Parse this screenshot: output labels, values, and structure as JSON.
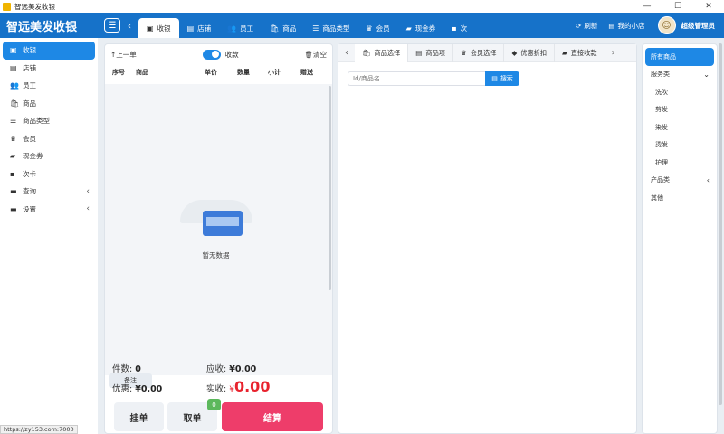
{
  "window": {
    "title": "智远美发收银",
    "buttons": [
      "—",
      "☐",
      "✕"
    ]
  },
  "header": {
    "brand": "智远美发收银",
    "tabs": [
      {
        "label": "收银",
        "icon": "cashier-icon",
        "glyph": "▣"
      },
      {
        "label": "店铺",
        "icon": "store-icon",
        "glyph": "▤"
      },
      {
        "label": "员工",
        "icon": "staff-icon",
        "glyph": "👥"
      },
      {
        "label": "商品",
        "icon": "bag-icon",
        "glyph": "🛍"
      },
      {
        "label": "商品类型",
        "icon": "list-icon",
        "glyph": "☰"
      },
      {
        "label": "会员",
        "icon": "crown-icon",
        "glyph": "♛"
      },
      {
        "label": "现金券",
        "icon": "ticket-icon",
        "glyph": "▰"
      },
      {
        "label": "次",
        "icon": "card-icon",
        "glyph": "▪"
      }
    ],
    "refresh": "刷新",
    "my_store": "我的小店",
    "user": "超级管理员"
  },
  "sidebar": {
    "items": [
      {
        "label": "收银",
        "glyph": "▣"
      },
      {
        "label": "店铺",
        "glyph": "▤"
      },
      {
        "label": "员工",
        "glyph": "👥"
      },
      {
        "label": "商品",
        "glyph": "🛍"
      },
      {
        "label": "商品类型",
        "glyph": "☰"
      },
      {
        "label": "会员",
        "glyph": "♛"
      },
      {
        "label": "现金券",
        "glyph": "▰"
      },
      {
        "label": "次卡",
        "glyph": "▪"
      },
      {
        "label": "查询",
        "glyph": "▬"
      },
      {
        "label": "设置",
        "glyph": "▬"
      }
    ]
  },
  "cart": {
    "prev_order": "上一单",
    "payment_toggle_label": "收款",
    "clear": "清空",
    "columns": [
      "序号",
      "商品",
      "单价",
      "数量",
      "小计",
      "赠送"
    ],
    "empty_text": "暂无数据",
    "remark": "备注",
    "count_label": "件数:",
    "count_value": "0",
    "receivable_label": "应收:",
    "receivable_value": "¥0.00",
    "discount_label": "优惠:",
    "discount_value": "¥0.00",
    "actual_label": "实收:",
    "actual_currency": "¥",
    "actual_value": "0.00",
    "hold_button": "挂单",
    "retrieve_button": "取单",
    "retrieve_badge": "0",
    "checkout_button": "结算"
  },
  "picker": {
    "tabs": [
      {
        "label": "商品选择",
        "glyph": "🛍"
      },
      {
        "label": "商品项",
        "glyph": "▤"
      },
      {
        "label": "会员选择",
        "glyph": "♛"
      },
      {
        "label": "优惠折扣",
        "glyph": "◆"
      },
      {
        "label": "直接收款",
        "glyph": "▰"
      }
    ],
    "search_placeholder": "Id/商品名",
    "search_button": "搜索"
  },
  "categories": {
    "items": [
      {
        "label": "所有商品",
        "type": "active"
      },
      {
        "label": "服务类",
        "type": "group"
      },
      {
        "label": "洗吹",
        "type": "sub"
      },
      {
        "label": "剪发",
        "type": "sub"
      },
      {
        "label": "染发",
        "type": "sub"
      },
      {
        "label": "烫发",
        "type": "sub"
      },
      {
        "label": "护理",
        "type": "sub"
      },
      {
        "label": "产品类",
        "type": "group"
      },
      {
        "label": "其他",
        "type": "plain"
      }
    ]
  },
  "statusbar": {
    "url": "https://zy153.com:7000"
  },
  "colors": {
    "primary": "#1672c9",
    "accent": "#1e88e5",
    "checkout": "#ee3d6a",
    "amount_red": "#e8232e",
    "badge": "#5cb85c"
  }
}
